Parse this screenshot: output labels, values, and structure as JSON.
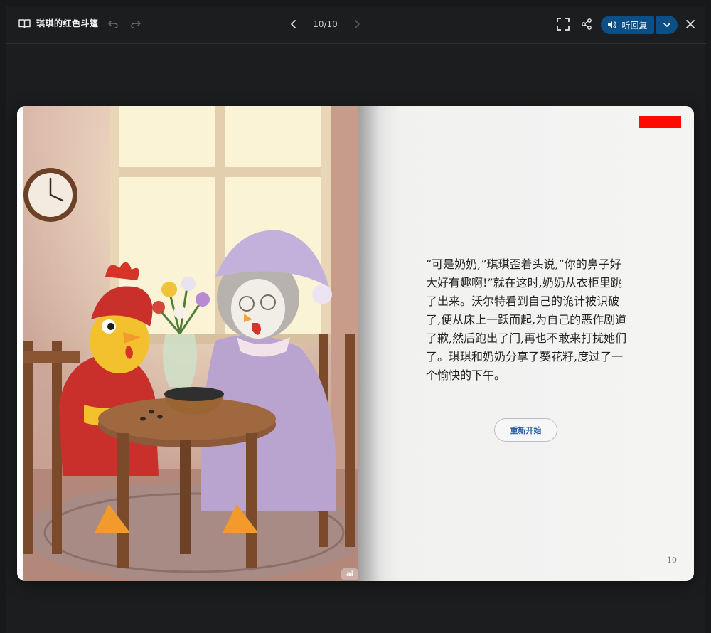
{
  "header": {
    "book_title": "琪琪的红色斗篷",
    "page_indicator": "10/10",
    "listen_label": "听回复"
  },
  "icons": {
    "book": "book-icon",
    "undo": "undo-icon",
    "redo": "redo-icon",
    "prev": "chevron-left-icon",
    "next": "chevron-right-icon",
    "fullscreen": "fullscreen-icon",
    "share": "share-icon",
    "speaker": "speaker-icon",
    "dropdown": "chevron-down-icon",
    "close": "close-icon"
  },
  "page": {
    "text": "“可是奶奶,”琪琪歪着头说,“你的鼻子好大好有趣啊!”就在这时,奶奶从衣柜里跳了出来。沃尔特看到自己的诡计被识破了,便从床上一跃而起,为自己的恶作剧道了歉,然后跑出了门,再也不敢来打扰她们了。琪琪和奶奶分享了葵花籽,度过了一个愉快的下午。",
    "restart_label": "重新开始",
    "page_number": "10",
    "ai_badge": "ai"
  },
  "colors": {
    "accent": "#0b4f86",
    "background": "#18191b",
    "red_mark": "#ff0a00"
  }
}
